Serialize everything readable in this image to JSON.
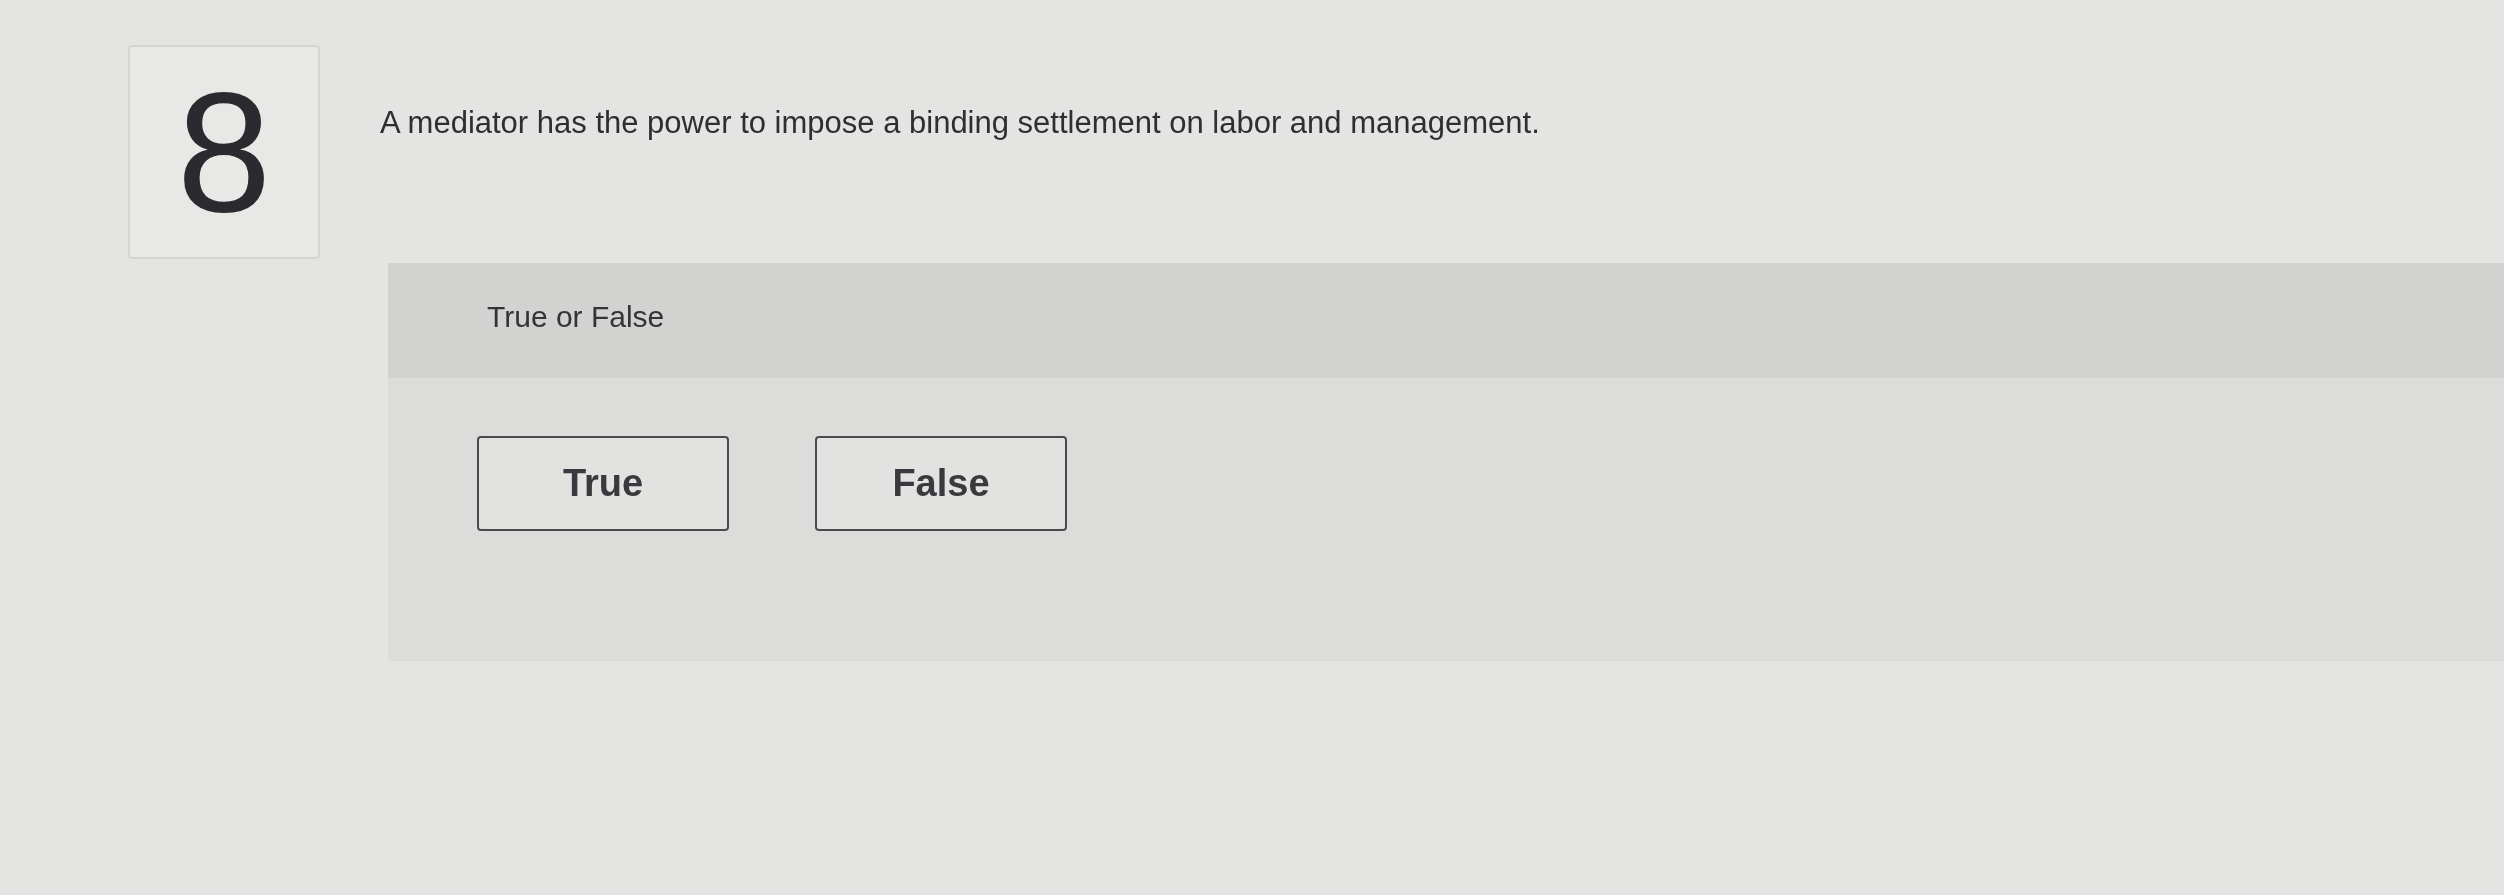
{
  "question": {
    "number": "8",
    "text": "A mediator has the power to impose a binding settlement on labor and management."
  },
  "answer_panel": {
    "prompt": "True or False",
    "options": [
      {
        "label": "True",
        "selected": false
      },
      {
        "label": "False",
        "selected": false
      }
    ]
  }
}
